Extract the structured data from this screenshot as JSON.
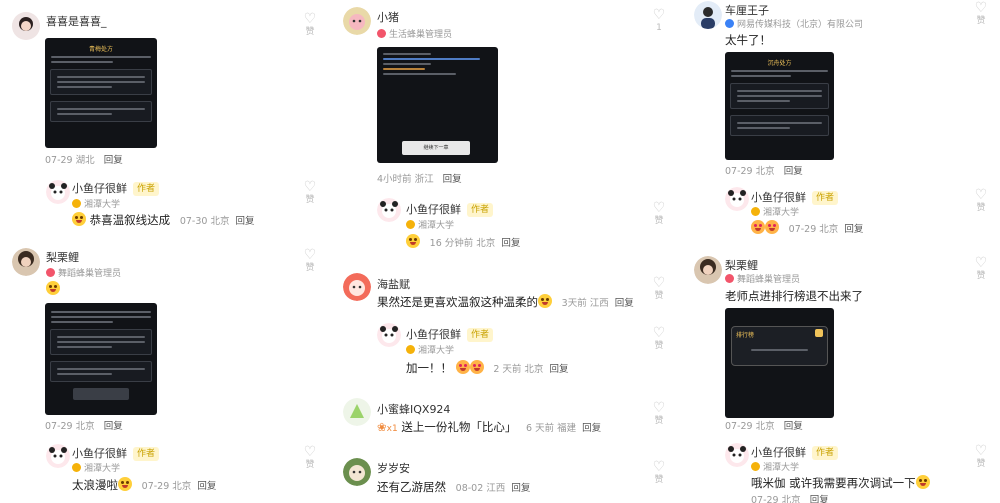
{
  "colors": {
    "like_gray": "#c8c8c8",
    "meta_gray": "#999999",
    "author_gold": "#c8a100",
    "badge_red": "#f2556b",
    "badge_gold": "#f5b20a"
  },
  "col1": {
    "c1": {
      "user": "喜喜是喜喜_",
      "date": "07-29",
      "location": "湖北",
      "reply": "回复",
      "like_label": "赞",
      "image_title": "青梅处方"
    },
    "r1": {
      "user": "小鱼仔很鲜",
      "author_tag": "作者",
      "school": "湘潭大学",
      "text": "恭喜温叙线达成",
      "date": "07-30",
      "location": "北京",
      "reply": "回复",
      "like_label": "赞"
    },
    "c2": {
      "user": "梨栗鲤",
      "role": "舞蹈蜂巢管理员",
      "date": "07-29",
      "location": "北京",
      "reply": "回复",
      "like_label": "赞"
    },
    "r2": {
      "user": "小鱼仔很鲜",
      "author_tag": "作者",
      "school": "湘潭大学",
      "text": "太浪漫啦",
      "date": "07-29",
      "location": "北京",
      "reply": "回复",
      "like_label": "赞"
    }
  },
  "col2": {
    "c1": {
      "user": "小猪",
      "role": "生活蜂巢管理员",
      "time": "4小时前",
      "location": "浙江",
      "reply": "回复",
      "like_count": "1",
      "image_button": "继续下一章"
    },
    "r1": {
      "user": "小鱼仔很鲜",
      "author_tag": "作者",
      "school": "湘潭大学",
      "time": "16 分钟前",
      "location": "北京",
      "reply": "回复",
      "like_label": "赞"
    },
    "c2": {
      "user": "海盐赋",
      "text": "果然还是更喜欢温叙这种温柔的",
      "time": "3天前",
      "location": "江西",
      "reply": "回复",
      "like_label": "赞"
    },
    "r2": {
      "user": "小鱼仔很鲜",
      "author_tag": "作者",
      "school": "湘潭大学",
      "text": "加一！！",
      "time": "2 天前",
      "location": "北京",
      "reply": "回复",
      "like_label": "赞"
    },
    "c3": {
      "user": "小蜜蜂IQX924",
      "gift_count": "x1",
      "text": "送上一份礼物「比心」",
      "time": "6 天前",
      "location": "福建",
      "reply": "回复",
      "like_label": "赞"
    },
    "c4": {
      "user": "岁岁安",
      "text": "还有乙游居然",
      "date": "08-02",
      "location": "江西",
      "reply": "回复",
      "like_label": "赞"
    }
  },
  "col3": {
    "c1": {
      "user": "车厘王子",
      "org": "网易传媒科技（北京）有限公司",
      "text": "太牛了！",
      "date": "07-29",
      "location": "北京",
      "reply": "回复",
      "like_label": "赞",
      "image_title": "沉舟处方"
    },
    "r1": {
      "user": "小鱼仔很鲜",
      "author_tag": "作者",
      "school": "湘潭大学",
      "date": "07-29",
      "location": "北京",
      "reply": "回复",
      "like_label": "赞"
    },
    "c2": {
      "user": "梨栗鲤",
      "role": "舞蹈蜂巢管理员",
      "text": "老师点进排行榜退不出来了",
      "date": "07-29",
      "location": "北京",
      "reply": "回复",
      "like_label": "赞",
      "image_title": "排行榜"
    },
    "r2": {
      "user": "小鱼仔很鲜",
      "author_tag": "作者",
      "school": "湘潭大学",
      "text": "哦米伽 或许我需要再次调试一下",
      "date": "07-29",
      "location": "北京",
      "reply": "回复",
      "like_label": "赞"
    }
  }
}
